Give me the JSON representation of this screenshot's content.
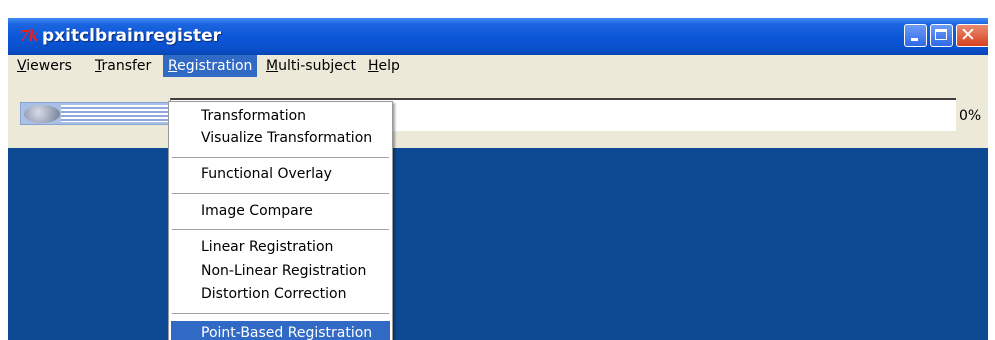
{
  "window": {
    "logo_text": "7k",
    "title": "pxitclbrainregister"
  },
  "menubar": {
    "items": [
      {
        "first": "V",
        "rest": "iewers"
      },
      {
        "first": "T",
        "rest": "ransfer"
      },
      {
        "first": "R",
        "rest": "egistration"
      },
      {
        "first": "M",
        "rest": "ulti-subject"
      },
      {
        "first": "H",
        "rest": "elp"
      }
    ]
  },
  "status": {
    "progress_percent": 0,
    "progress_text": "0%"
  },
  "registration_menu": {
    "items": [
      "Transformation",
      "Visualize Transformation",
      "Functional Overlay",
      "Image Compare",
      "Linear Registration",
      "Non-Linear Registration",
      "Distortion Correction",
      "Point-Based Registration"
    ],
    "highlighted": "Point-Based Registration"
  },
  "colors": {
    "titlebar": "#0b56d8",
    "desktop": "#0d4a93",
    "menu_highlight": "#316ac5",
    "close_button": "#d6411f"
  }
}
